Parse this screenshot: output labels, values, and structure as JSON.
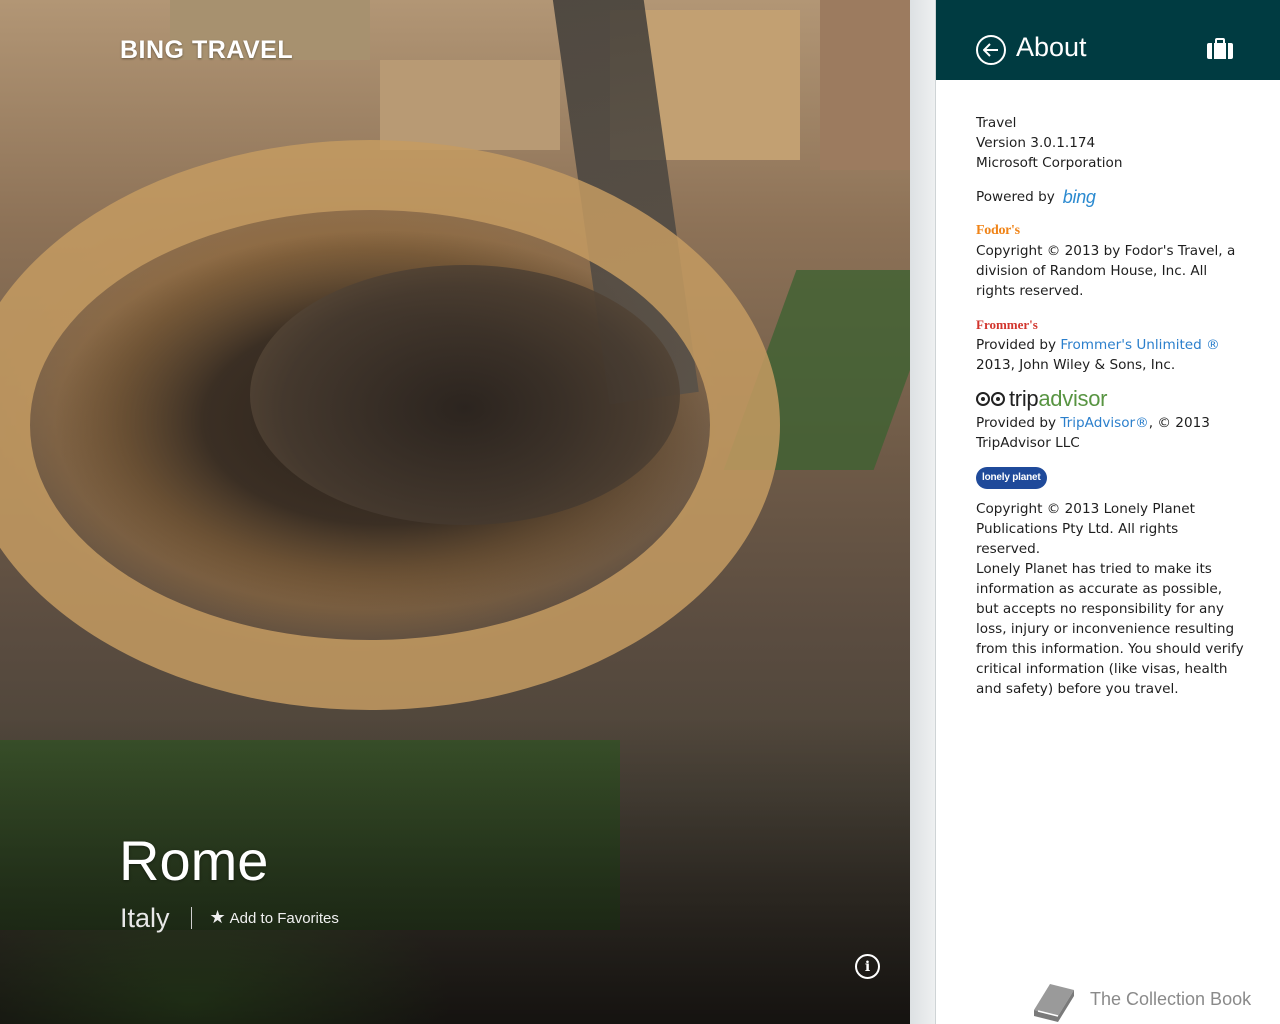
{
  "app": {
    "brand": "BING TRAVEL"
  },
  "destination": {
    "city": "Rome",
    "country": "Italy",
    "favorite_label": "Add to Favorites"
  },
  "icons": {
    "favorite": "star-icon",
    "info": "info-icon",
    "back": "back-arrow-icon",
    "header": "suitcase-icon",
    "watermark": "book-icon"
  },
  "about": {
    "title": "About",
    "app_name": "Travel",
    "version": "Version 3.0.1.174",
    "publisher": "Microsoft Corporation",
    "powered_by": "Powered by",
    "powered_logo": "bing",
    "fodors": {
      "logo": "Fodor's",
      "text": "Copyright © 2013 by Fodor's Travel, a division of Random House, Inc. All rights reserved."
    },
    "frommers": {
      "logo": "Frommer's",
      "provided_by": "Provided by ",
      "link": "Frommer's Unlimited ®",
      "suffix": "2013, John Wiley & Sons, Inc."
    },
    "tripadvisor": {
      "logo_prefix": "trip",
      "logo_suffix": "advisor",
      "provided_by": "Provided by ",
      "link": "TripAdvisor®",
      "suffix": ", © 2013 TripAdvisor LLC"
    },
    "lonely_planet": {
      "logo": "lonely planet",
      "copyright": "Copyright © 2013 Lonely Planet Publications Pty Ltd. All rights reserved.",
      "disclaimer": "Lonely Planet has tried to make its information as accurate as possible, but accepts no responsibility for any loss, injury or inconvenience resulting from this information. You should verify critical information (like visas, health and safety) before you travel."
    }
  },
  "watermark": {
    "text": "The Collection Book"
  },
  "colors": {
    "header_bg": "#003b41",
    "link": "#2b7fcc",
    "bing": "#2b8ad0",
    "fodors": "#f08418",
    "frommers": "#d2352d",
    "tripadvisor_green": "#589442",
    "lonely_planet_blue": "#1f4a9a"
  }
}
